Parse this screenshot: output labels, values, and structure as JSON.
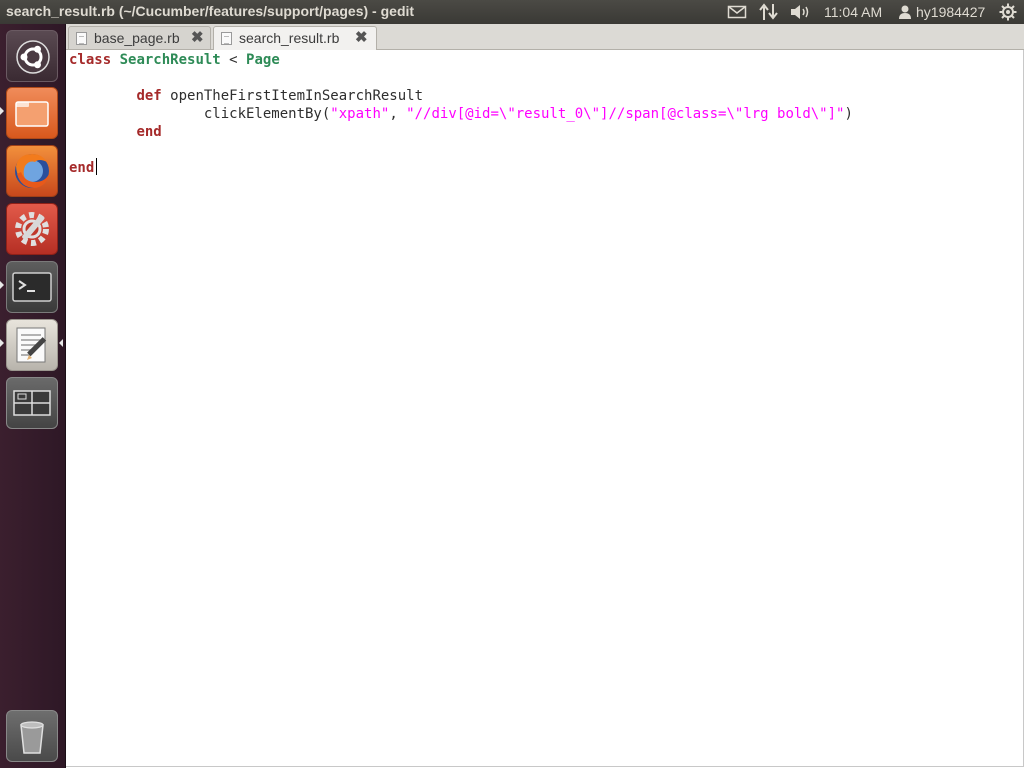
{
  "window": {
    "title": "search_result.rb (~/Cucumber/features/support/pages) - gedit"
  },
  "panel": {
    "clock": "11:04 AM",
    "username": "hy1984427",
    "icons": [
      "mail-icon",
      "network-icon",
      "volume-icon",
      "user-icon",
      "gear-icon"
    ]
  },
  "launcher": {
    "items": [
      "dash-home",
      "files",
      "firefox",
      "system-settings",
      "terminal",
      "text-editor",
      "workspace-switcher",
      "trash"
    ]
  },
  "tabs": [
    {
      "label": "base_page.rb",
      "active": false
    },
    {
      "label": "search_result.rb",
      "active": true
    }
  ],
  "code": {
    "line1": {
      "kw": "class",
      "name": "SearchResult",
      "op": " < ",
      "parent": "Page"
    },
    "line3": {
      "indent": "        ",
      "kw": "def",
      "rest": " openTheFirstItemInSearchResult"
    },
    "line4": {
      "indent": "                ",
      "call": "clickElementBy(",
      "arg1": "\"xpath\"",
      "sep": ", ",
      "arg2": "\"//div[@id=\\\"result_0\\\"]//span[@class=\\\"lrg bold\\\"]\"",
      "close": ")"
    },
    "line5": {
      "indent": "        ",
      "kw": "end"
    },
    "line7": {
      "kw": "end"
    }
  },
  "colors": {
    "keyword": "#a52a2a",
    "class_name": "#2e8b57",
    "string": "#ff00ff"
  }
}
